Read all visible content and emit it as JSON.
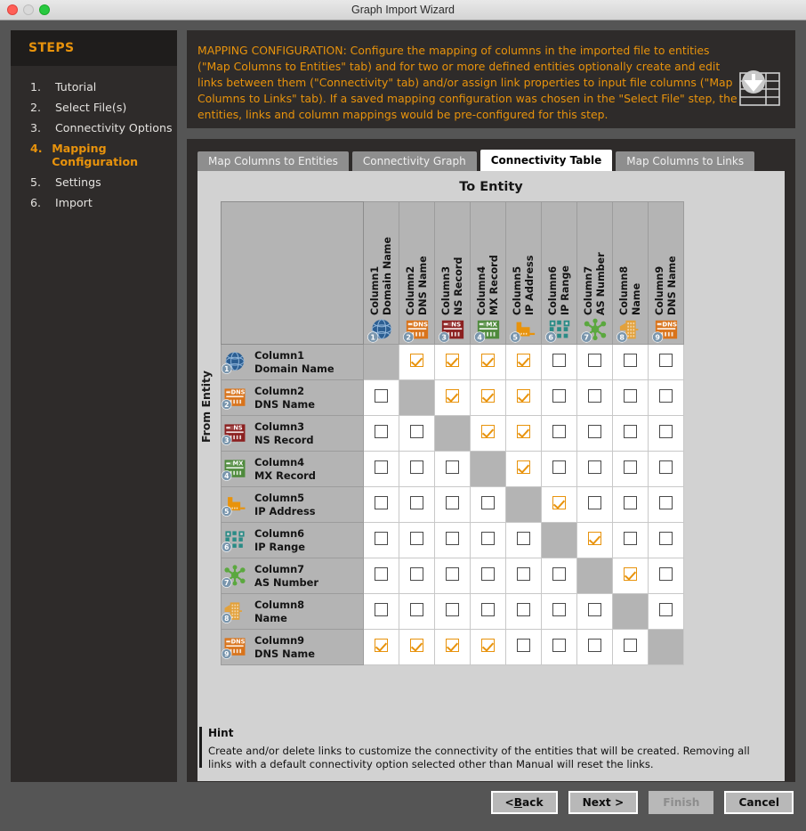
{
  "window": {
    "title": "Graph Import Wizard",
    "controls": {
      "close": "close-button",
      "minimize": "minimize-button",
      "maximize": "maximize-button"
    }
  },
  "sidebar": {
    "header": "STEPS",
    "items": [
      {
        "num": "1.",
        "label": "Tutorial",
        "active": false
      },
      {
        "num": "2.",
        "label": "Select File(s)",
        "active": false
      },
      {
        "num": "3.",
        "label": "Connectivity Options",
        "active": false
      },
      {
        "num": "4.",
        "label": "Mapping Configuration",
        "active": true
      },
      {
        "num": "5.",
        "label": "Settings",
        "active": false
      },
      {
        "num": "6.",
        "label": "Import",
        "active": false
      }
    ]
  },
  "banner": {
    "text": "MAPPING CONFIGURATION: Configure the mapping of columns in the imported file to entities (\"Map Columns to Entities\" tab) and for two or more defined entities optionally create and edit links between them (\"Connectivity\" tab) and/or assign link properties to input file columns (\"Map Columns to Links\" tab). If a saved mapping configuration was chosen in the \"Select File\" step, the entities, links and column mappings would be pre-configured for this step.",
    "icon": "import-table-icon"
  },
  "tabs": [
    {
      "label": "Map Columns to Entities",
      "active": false
    },
    {
      "label": "Connectivity Graph",
      "active": false
    },
    {
      "label": "Connectivity Table",
      "active": true
    },
    {
      "label": "Map Columns to Links",
      "active": false
    }
  ],
  "table": {
    "to_entity_label": "To Entity",
    "from_entity_label": "From Entity",
    "entities": [
      {
        "num": "1",
        "line1": "Column1",
        "line2": "Domain Name",
        "icon": "globe-icon",
        "color": "#2b5e92"
      },
      {
        "num": "2",
        "line1": "Column2",
        "line2": "DNS Name",
        "icon": "dns-icon",
        "color": "#d9731a"
      },
      {
        "num": "3",
        "line1": "Column3",
        "line2": "NS Record",
        "icon": "ns-icon",
        "color": "#8b1f1f"
      },
      {
        "num": "4",
        "line1": "Column4",
        "line2": "MX Record",
        "icon": "mx-icon",
        "color": "#4e8a3c"
      },
      {
        "num": "5",
        "line1": "Column5",
        "line2": "IP Address",
        "icon": "ip-address-icon",
        "color": "#e8930c"
      },
      {
        "num": "6",
        "line1": "Column6",
        "line2": "IP Range",
        "icon": "ip-range-icon",
        "color": "#2a8b86"
      },
      {
        "num": "7",
        "line1": "Column7",
        "line2": "AS Number",
        "icon": "as-number-icon",
        "color": "#5ba83f"
      },
      {
        "num": "8",
        "line1": "Column8",
        "line2": "Name",
        "icon": "building-icon",
        "color": "#e3a13a"
      },
      {
        "num": "9",
        "line1": "Column9",
        "line2": "DNS Name",
        "icon": "dns-icon",
        "color": "#d9731a"
      }
    ],
    "matrix": [
      [
        null,
        true,
        true,
        true,
        true,
        false,
        false,
        false,
        false
      ],
      [
        false,
        null,
        true,
        true,
        true,
        false,
        false,
        false,
        false
      ],
      [
        false,
        false,
        null,
        true,
        true,
        false,
        false,
        false,
        false
      ],
      [
        false,
        false,
        false,
        null,
        true,
        false,
        false,
        false,
        false
      ],
      [
        false,
        false,
        false,
        false,
        null,
        true,
        false,
        false,
        false
      ],
      [
        false,
        false,
        false,
        false,
        false,
        null,
        true,
        false,
        false
      ],
      [
        false,
        false,
        false,
        false,
        false,
        false,
        null,
        true,
        false
      ],
      [
        false,
        false,
        false,
        false,
        false,
        false,
        false,
        null,
        false
      ],
      [
        true,
        true,
        true,
        true,
        false,
        false,
        false,
        false,
        null
      ]
    ]
  },
  "hint": {
    "title": "Hint",
    "body": "Create and/or delete links to customize the connectivity of the entities that will be created. Removing all links with a default connectivity option selected other than Manual will reset the links."
  },
  "footer": {
    "buttons": [
      {
        "label": "< Back",
        "underline": "B",
        "disabled": false
      },
      {
        "label": "Next >",
        "underline": "",
        "disabled": false
      },
      {
        "label": "Finish",
        "underline": "",
        "disabled": true
      },
      {
        "label": "Cancel",
        "underline": "",
        "disabled": false
      }
    ]
  },
  "colors": {
    "accent": "#e8930c",
    "panel_dark": "#2e2b2a",
    "panel_darker": "#1f1d1c",
    "window_bg": "#555555",
    "tab_panel": "#d2d2d2",
    "header_cell": "#b4b4b4"
  }
}
